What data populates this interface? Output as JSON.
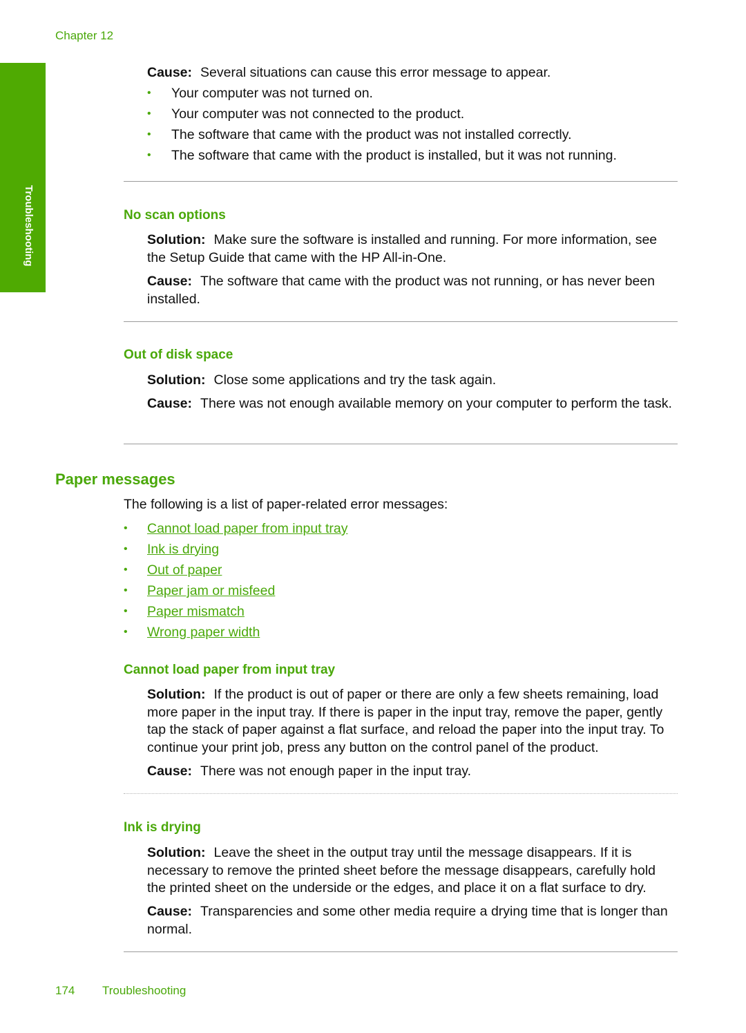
{
  "header": {
    "chapter": "Chapter 12"
  },
  "side_tab": {
    "label": "Troubleshooting",
    "color": "#4faa02"
  },
  "intro": {
    "cause_label": "Cause:",
    "cause_text": "Several situations can cause this error message to appear.",
    "bullets": [
      "Your computer was not turned on.",
      "Your computer was not connected to the product.",
      "The software that came with the product was not installed correctly.",
      "The software that came with the product is installed, but it was not running."
    ]
  },
  "sections": [
    {
      "title": "No scan options",
      "solution_label": "Solution:",
      "solution_text": "Make sure the software is installed and running. For more information, see the Setup Guide that came with the HP All-in-One.",
      "cause_label": "Cause:",
      "cause_text": "The software that came with the product was not running, or has never been installed."
    },
    {
      "title": "Out of disk space",
      "solution_label": "Solution:",
      "solution_text": "Close some applications and try the task again.",
      "cause_label": "Cause:",
      "cause_text": "There was not enough available memory on your computer to perform the task."
    }
  ],
  "paper": {
    "title": "Paper messages",
    "intro": "The following is a list of paper-related error messages:",
    "links": [
      "Cannot load paper from input tray",
      "Ink is drying",
      "Out of paper",
      "Paper jam or misfeed",
      "Paper mismatch",
      "Wrong paper width"
    ],
    "sections": [
      {
        "title": "Cannot load paper from input tray",
        "solution_label": "Solution:",
        "solution_text": "If the product is out of paper or there are only a few sheets remaining, load more paper in the input tray. If there is paper in the input tray, remove the paper, gently tap the stack of paper against a flat surface, and reload the paper into the input tray. To continue your print job, press any button on the control panel of the product.",
        "cause_label": "Cause:",
        "cause_text": "There was not enough paper in the input tray."
      },
      {
        "title": "Ink is drying",
        "solution_label": "Solution:",
        "solution_text": "Leave the sheet in the output tray until the message disappears. If it is necessary to remove the printed sheet before the message disappears, carefully hold the printed sheet on the underside or the edges, and place it on a flat surface to dry.",
        "cause_label": "Cause:",
        "cause_text": "Transparencies and some other media require a drying time that is longer than normal."
      }
    ]
  },
  "footer": {
    "page_number": "174",
    "title": "Troubleshooting"
  },
  "colors": {
    "accent": "#4aa80a",
    "rule": "#9a9a9a",
    "text": "#111111"
  }
}
